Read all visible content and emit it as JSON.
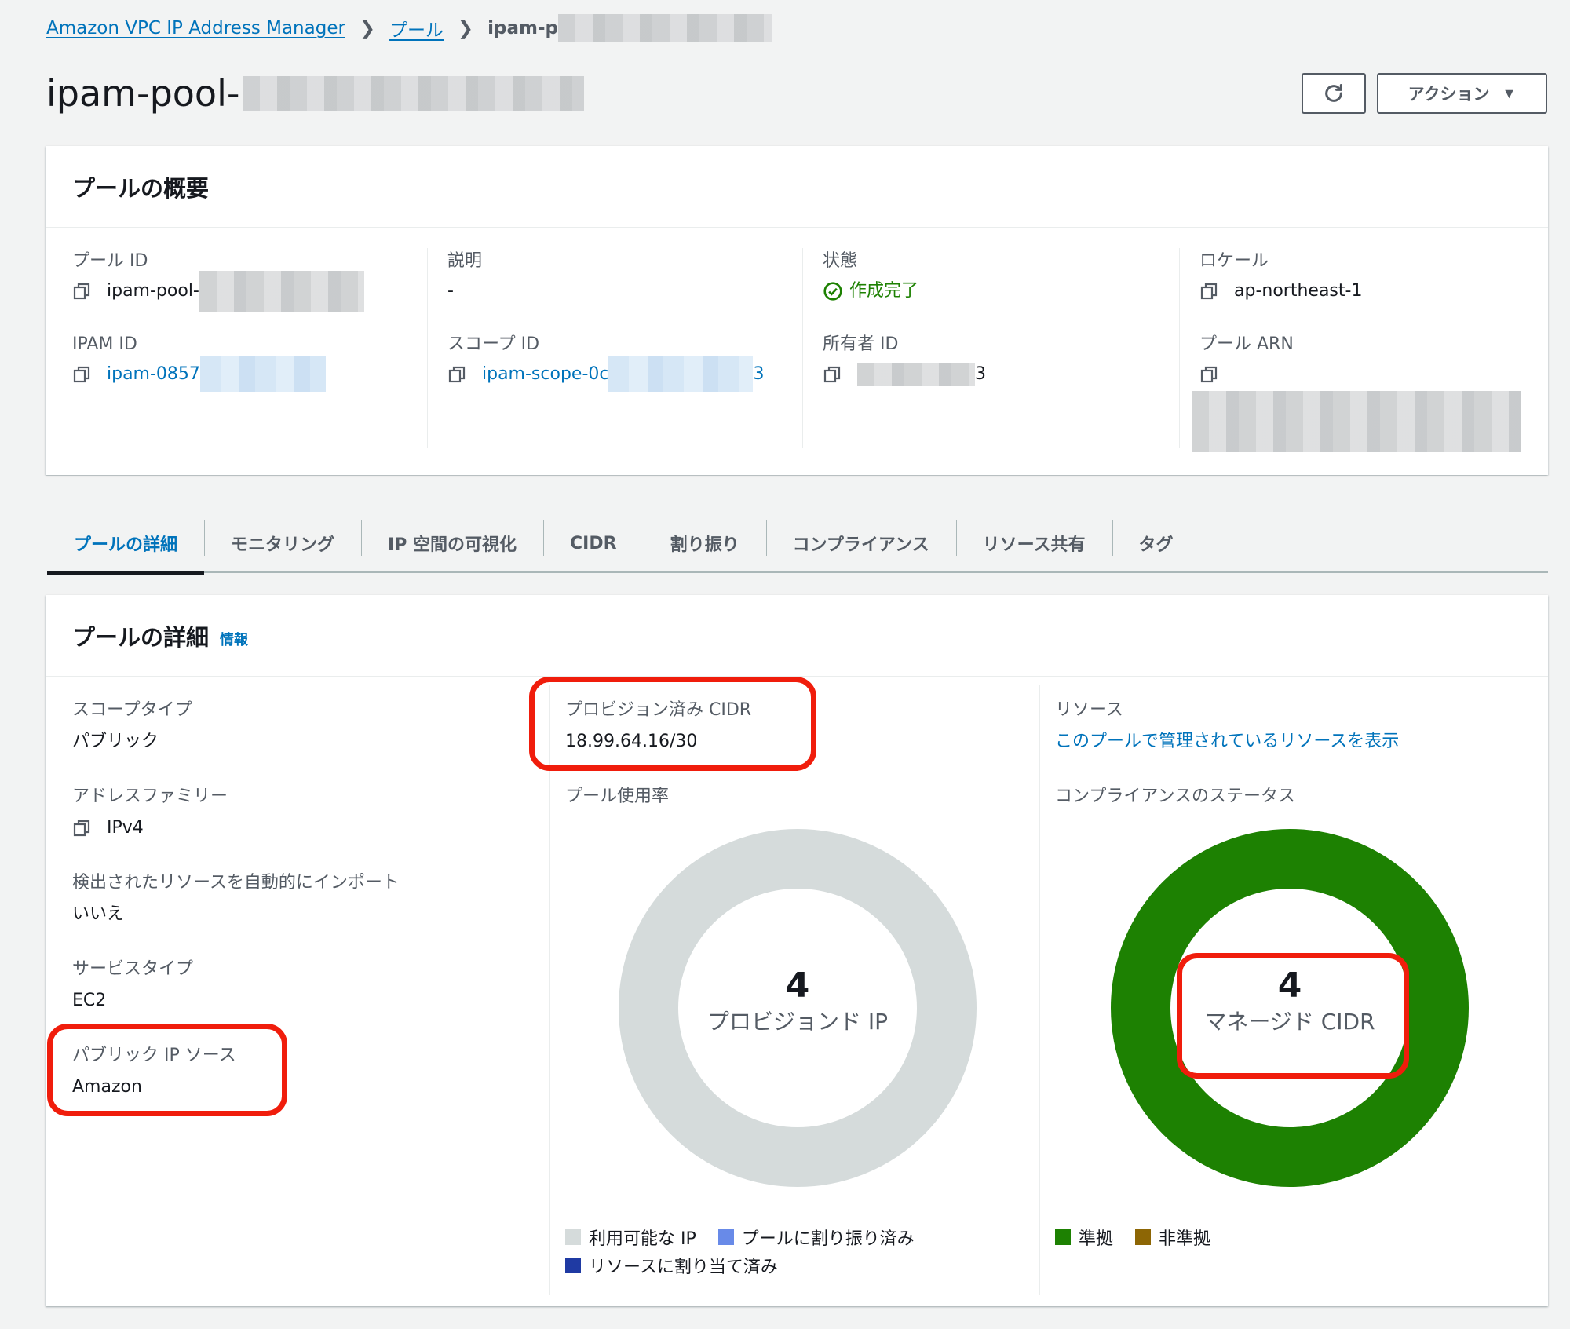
{
  "breadcrumb": {
    "root": "Amazon VPC IP Address Manager",
    "pools": "プール",
    "current": "ipam-p"
  },
  "page": {
    "title": "ipam-pool-"
  },
  "toolbar": {
    "refresh_icon": "refresh-icon",
    "action_label": "アクション"
  },
  "overview": {
    "title": "プールの概要",
    "pool_id": {
      "label": "プール ID",
      "value": "ipam-pool-"
    },
    "ipam_id": {
      "label": "IPAM ID",
      "value": "ipam-0857"
    },
    "description": {
      "label": "説明",
      "value": "-"
    },
    "scope_id": {
      "label": "スコープ ID",
      "value": "ipam-scope-0c",
      "value_suffix": "3"
    },
    "state": {
      "label": "状態",
      "value": "作成完了"
    },
    "owner_id": {
      "label": "所有者 ID",
      "value_suffix": "3"
    },
    "locale": {
      "label": "ロケール",
      "value": "ap-northeast-1"
    },
    "pool_arn": {
      "label": "プール ARN"
    }
  },
  "tabs": [
    {
      "label": "プールの詳細",
      "active": true
    },
    {
      "label": "モニタリング"
    },
    {
      "label": "IP 空間の可視化"
    },
    {
      "label": "CIDR"
    },
    {
      "label": "割り振り"
    },
    {
      "label": "コンプライアンス"
    },
    {
      "label": "リソース共有"
    },
    {
      "label": "タグ"
    }
  ],
  "details": {
    "title": "プールの詳細",
    "info_link": "情報",
    "scope_type": {
      "label": "スコープタイプ",
      "value": "パブリック"
    },
    "address_family": {
      "label": "アドレスファミリー",
      "value": "IPv4"
    },
    "auto_import": {
      "label": "検出されたリソースを自動的にインポート",
      "value": "いいえ"
    },
    "service_type": {
      "label": "サービスタイプ",
      "value": "EC2"
    },
    "public_ip_source": {
      "label": "パブリック IP ソース",
      "value": "Amazon"
    },
    "provisioned_cidr": {
      "label": "プロビジョン済み CIDR",
      "value": "18.99.64.16/30"
    },
    "pool_usage": {
      "label": "プール使用率",
      "center_value": "4",
      "center_label": "プロビジョンド IP",
      "legend": [
        {
          "label": "利用可能な IP",
          "color": "#d5dbdb"
        },
        {
          "label": "プールに割り振り済み",
          "color": "#688ae8"
        },
        {
          "label": "リソースに割り当て済み",
          "color": "#1f3aa3"
        }
      ]
    },
    "resources": {
      "label": "リソース",
      "link": "このプールで管理されているリソースを表示"
    },
    "compliance": {
      "label": "コンプライアンスのステータス",
      "center_value": "4",
      "center_label": "マネージド CIDR",
      "legend": [
        {
          "label": "準拠",
          "color": "#1d8102"
        },
        {
          "label": "非準拠",
          "color": "#8d6605"
        }
      ]
    }
  }
}
